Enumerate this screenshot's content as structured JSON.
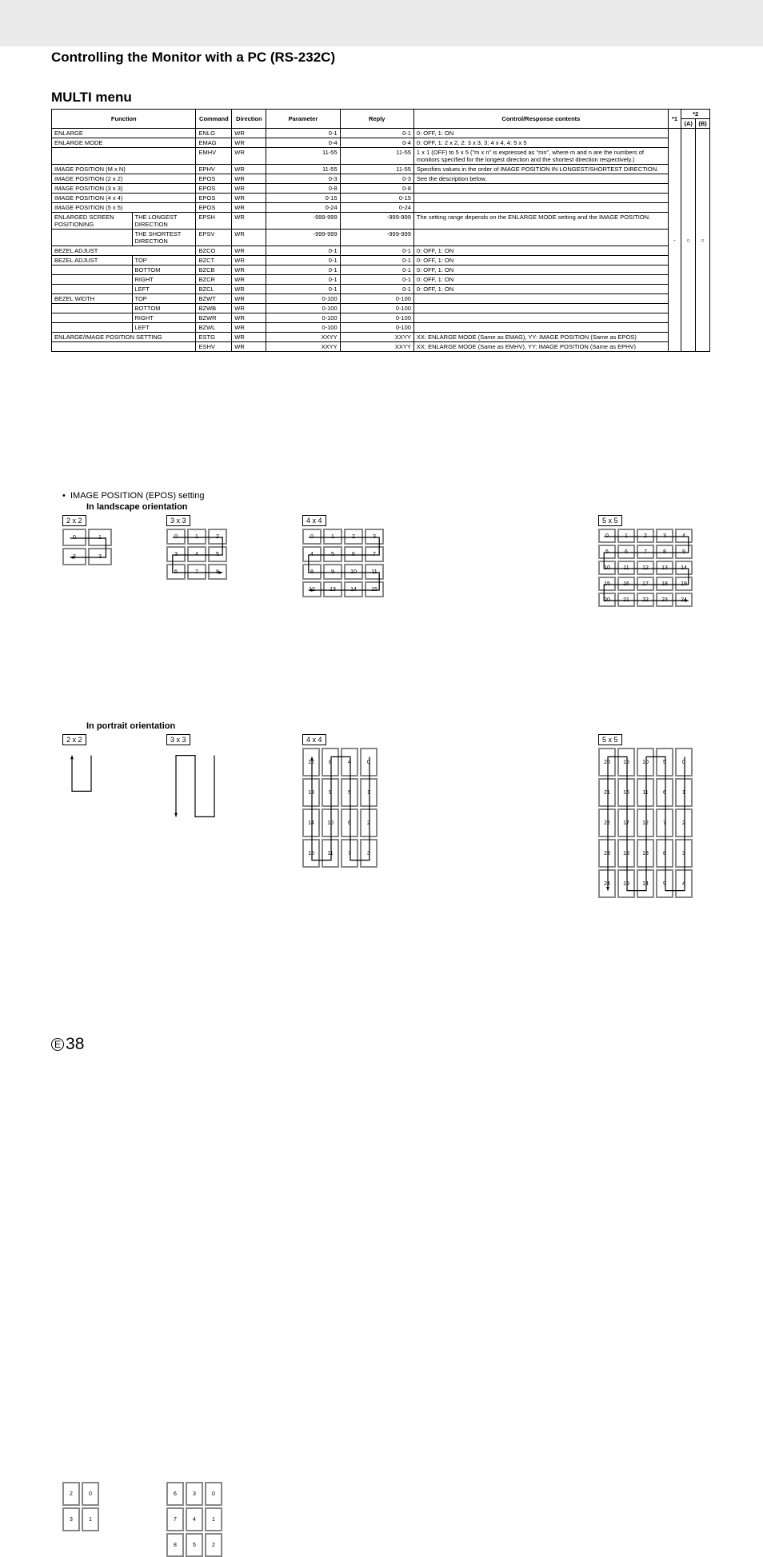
{
  "page": {
    "title": "Controlling the Monitor with a PC (RS-232C)",
    "section": "MULTI menu",
    "epos_line": "IMAGE POSITION (EPOS) setting",
    "epos_landscape": "In landscape orientation",
    "epos_portrait": "In portrait orientation",
    "page_number": "38",
    "page_letter": "E"
  },
  "table": {
    "headers": {
      "function": "Function",
      "command": "Command",
      "direction": "Direction",
      "parameter": "Parameter",
      "reply": "Reply",
      "content": "Control/Response contents",
      "star1": "*1",
      "star2": "*2",
      "a": "(A)",
      "b": "(B)"
    },
    "rows": [
      {
        "f1": "ENLARGE",
        "f2": "",
        "cmd": "ENLG",
        "dir": "WR",
        "par": "0-1",
        "rep": "0-1",
        "cont": "0: OFF, 1: ON",
        "span": 2
      },
      {
        "f1": "ENLARGE MODE",
        "f2": "",
        "cmd": "EMAG",
        "dir": "WR",
        "par": "0-4",
        "rep": "0-4",
        "cont": "0: OFF, 1: 2 x 2, 2: 3 x 3, 3: 4 x 4, 4: 5 x 5",
        "span": 2
      },
      {
        "f1": "",
        "f2": "",
        "cmd": "EMHV",
        "dir": "WR",
        "par": "11-55",
        "rep": "11-55",
        "cont": "1 x 1 (OFF) to 5 x 5 (\"m x n\" is expressed as \"mn\", where m and n are the numbers of monitors specified for the longest direction and the shortest direction respectively.)",
        "span": 2,
        "noTopF": true
      },
      {
        "f1": "IMAGE POSITION (M x N)",
        "f2": "",
        "cmd": "EPHV",
        "dir": "WR",
        "par": "11-55",
        "rep": "11-55",
        "cont": "Specifies values in the order of IMAGE POSITION IN LONGEST/SHORTEST DIRECTION.",
        "span": 2
      },
      {
        "f1": "IMAGE POSITION (2 x 2)",
        "f2": "",
        "cmd": "EPOS",
        "dir": "WR",
        "par": "0-3",
        "rep": "0-3",
        "cont": "See the description below.",
        "span": 2
      },
      {
        "f1": "IMAGE POSITION (3 x 3)",
        "f2": "",
        "cmd": "EPOS",
        "dir": "WR",
        "par": "0-8",
        "rep": "0-8",
        "cont": "",
        "span": 2,
        "merge_cont": true
      },
      {
        "f1": "IMAGE POSITION (4 x 4)",
        "f2": "",
        "cmd": "EPOS",
        "dir": "WR",
        "par": "0-15",
        "rep": "0-15",
        "cont": "",
        "span": 2,
        "merge_cont": true
      },
      {
        "f1": "IMAGE POSITION (5 x 5)",
        "f2": "",
        "cmd": "EPOS",
        "dir": "WR",
        "par": "0-24",
        "rep": "0-24",
        "cont": "",
        "span": 2,
        "merge_cont": true
      },
      {
        "f1": "ENLARGED SCREEN POSITIONING",
        "f2": "THE LONGEST DIRECTION",
        "cmd": "EPSH",
        "dir": "WR",
        "par": "-999-999",
        "rep": "-999-999",
        "cont": "The setting range depends on the ENLARGE MODE setting and the IMAGE POSITION.",
        "split": true
      },
      {
        "f1": "",
        "f2": "THE SHORTEST DIRECTION",
        "cmd": "EPSV",
        "dir": "WR",
        "par": "-999-999",
        "rep": "-999-999",
        "cont": "",
        "split": true,
        "merge_cont": true,
        "noTopF1": true
      },
      {
        "f1": "BEZEL ADJUST",
        "f2": "",
        "cmd": "BZCO",
        "dir": "WR",
        "par": "0-1",
        "rep": "0-1",
        "cont": "0: OFF, 1: ON",
        "span": 2
      },
      {
        "f1": "BEZEL ADJUST",
        "f2": "TOP",
        "cmd": "BZCT",
        "dir": "WR",
        "par": "0-1",
        "rep": "0-1",
        "cont": "0: OFF, 1: ON",
        "split": true
      },
      {
        "f1": "",
        "f2": "BOTTOM",
        "cmd": "BZCB",
        "dir": "WR",
        "par": "0-1",
        "rep": "0-1",
        "cont": "0: OFF, 1: ON",
        "split": true,
        "noTopF1": true
      },
      {
        "f1": "",
        "f2": "RIGHT",
        "cmd": "BZCR",
        "dir": "WR",
        "par": "0-1",
        "rep": "0-1",
        "cont": "0: OFF, 1: ON",
        "split": true,
        "noTopF1": true
      },
      {
        "f1": "",
        "f2": "LEFT",
        "cmd": "BZCL",
        "dir": "WR",
        "par": "0-1",
        "rep": "0-1",
        "cont": "0: OFF, 1: ON",
        "split": true,
        "noTopF1": true
      },
      {
        "f1": "BEZEL WIDTH",
        "f2": "TOP",
        "cmd": "BZWT",
        "dir": "WR",
        "par": "0-100",
        "rep": "0-100",
        "cont": "",
        "split": true
      },
      {
        "f1": "",
        "f2": "BOTTOM",
        "cmd": "BZWB",
        "dir": "WR",
        "par": "0-100",
        "rep": "0-100",
        "cont": "",
        "split": true,
        "noTopF1": true,
        "merge_cont": true
      },
      {
        "f1": "",
        "f2": "RIGHT",
        "cmd": "BZWR",
        "dir": "WR",
        "par": "0-100",
        "rep": "0-100",
        "cont": "",
        "split": true,
        "noTopF1": true,
        "merge_cont": true
      },
      {
        "f1": "",
        "f2": "LEFT",
        "cmd": "BZWL",
        "dir": "WR",
        "par": "0-100",
        "rep": "0-100",
        "cont": "",
        "split": true,
        "noTopF1": true,
        "merge_cont": true
      },
      {
        "f1": "ENLARGE/IMAGE POSITION SETTING",
        "f2": "",
        "cmd": "ESTG",
        "dir": "WR",
        "par": "XXYY",
        "rep": "XXYY",
        "cont": "XX: ENLARGE MODE (Same as EMAG), YY: IMAGE POSITION (Same as EPOS)",
        "span": 2
      },
      {
        "f1": "",
        "f2": "",
        "cmd": "ESHV",
        "dir": "WR",
        "par": "XXYY",
        "rep": "XXYY",
        "cont": "XX: ENLARGE MODE (Same as EMHV), YY: IMAGE POSITION (Same as EPHV)",
        "span": 2,
        "noTopF": true
      }
    ],
    "marks": {
      "s1": "-",
      "s2a": "○",
      "s2b": "○"
    }
  },
  "diagrams": {
    "labels": {
      "2x2": "2 x 2",
      "3x3": "3 x 3",
      "4x4": "4 x 4",
      "5x5": "5 x 5"
    },
    "landscape": {
      "2x2": [
        [
          0,
          1
        ],
        [
          2,
          3
        ]
      ],
      "3x3": [
        [
          0,
          1,
          2
        ],
        [
          3,
          4,
          5
        ],
        [
          6,
          7,
          8
        ]
      ],
      "4x4": [
        [
          0,
          1,
          2,
          3
        ],
        [
          4,
          5,
          6,
          7
        ],
        [
          8,
          9,
          10,
          11
        ],
        [
          12,
          13,
          14,
          15
        ]
      ],
      "5x5": [
        [
          0,
          1,
          2,
          3,
          4
        ],
        [
          5,
          6,
          7,
          8,
          9
        ],
        [
          10,
          11,
          12,
          13,
          14
        ],
        [
          15,
          16,
          17,
          18,
          19
        ],
        [
          20,
          21,
          22,
          23,
          24
        ]
      ]
    },
    "portrait": {
      "2x2": [
        [
          2,
          0
        ],
        [
          3,
          1
        ]
      ],
      "3x3": [
        [
          6,
          3,
          0
        ],
        [
          7,
          4,
          1
        ],
        [
          8,
          5,
          2
        ]
      ],
      "4x4": [
        [
          12,
          8,
          4,
          0
        ],
        [
          13,
          9,
          5,
          1
        ],
        [
          14,
          10,
          6,
          2
        ],
        [
          15,
          11,
          7,
          3
        ]
      ],
      "5x5": [
        [
          20,
          15,
          10,
          5,
          0
        ],
        [
          21,
          16,
          11,
          6,
          1
        ],
        [
          22,
          17,
          12,
          7,
          2
        ],
        [
          23,
          18,
          13,
          8,
          3
        ],
        [
          24,
          19,
          14,
          9,
          4
        ]
      ]
    }
  }
}
